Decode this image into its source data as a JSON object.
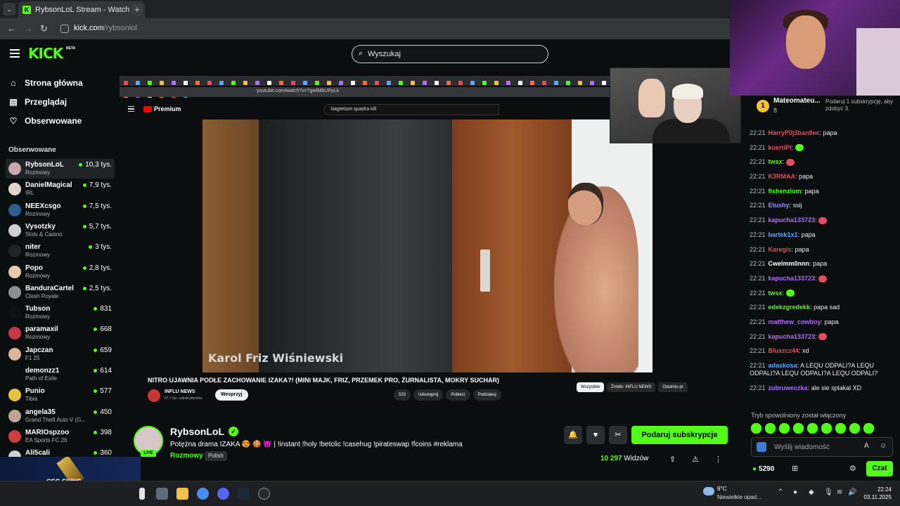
{
  "browser": {
    "tab_title": "RybsonLoL Stream - Watch Live",
    "tab_close": "×",
    "new_tab": "+",
    "url_host": "kick.com",
    "url_path": "/rybsonlol"
  },
  "header": {
    "logo": "KICK",
    "beta": "BETA",
    "search_placeholder": "Wyszukaj"
  },
  "sidebar": {
    "nav": [
      {
        "label": "Strona główna",
        "icon": "home-icon"
      },
      {
        "label": "Przeglądaj",
        "icon": "browse-icon"
      },
      {
        "label": "Obserwowane",
        "icon": "heart-icon"
      }
    ],
    "section_title": "Obserwowane",
    "channels": [
      {
        "name": "RybsonLoL",
        "category": "Rozmowy",
        "viewers": "10,3 tys.",
        "color": "#c9a9ad"
      },
      {
        "name": "DanielMagical",
        "category": "IRL",
        "viewers": "7,9 tys.",
        "color": "#e0d6cf"
      },
      {
        "name": "NEEXcsgo",
        "category": "Rozmowy",
        "viewers": "7,5 tys.",
        "color": "#2d5c8f"
      },
      {
        "name": "Vysotzky",
        "category": "Slots & Casino",
        "viewers": "5,7 tys.",
        "color": "#cfcfcf"
      },
      {
        "name": "niter",
        "category": "Rozmowy",
        "viewers": "3 tys.",
        "color": "#222"
      },
      {
        "name": "Popo",
        "category": "Rozmowy",
        "viewers": "2,8 tys.",
        "color": "#e8c9a8"
      },
      {
        "name": "BanduraCartel",
        "category": "Clash Royale",
        "viewers": "2,5 tys.",
        "color": "#8f8f8f"
      },
      {
        "name": "Tubson",
        "category": "Rozmowy",
        "viewers": "831",
        "color": "#111"
      },
      {
        "name": "paramaxil",
        "category": "Rozmowy",
        "viewers": "668",
        "color": "#c23a4a"
      },
      {
        "name": "Japczan",
        "category": "F1 25",
        "viewers": "659",
        "color": "#d9b4a0"
      },
      {
        "name": "demonzz1",
        "category": "Path of Exile",
        "viewers": "614",
        "color": "#0d0d0d"
      },
      {
        "name": "Punio",
        "category": "Tibia",
        "viewers": "577",
        "color": "#e3c23c"
      },
      {
        "name": "angela35",
        "category": "Grand Theft Auto V (G...",
        "viewers": "450",
        "color": "#bfa39a"
      },
      {
        "name": "MARIOspzoo",
        "category": "EA Sports FC 26",
        "viewers": "398",
        "color": "#c93f3f"
      },
      {
        "name": "Ali5cali",
        "category": "",
        "viewers": "360",
        "color": "#cfcfcf"
      }
    ]
  },
  "video": {
    "inner_url": "youtube.com/watch?v=7gwfMbUPpLk",
    "yt_logo": "Premium",
    "yt_search": "bagietson quadra kill",
    "watermark": "Karol Friz Wiśniewski",
    "yt_title": "NITRO UJAWNIA PODŁE ZACHOWANIE IZAKA?! (MINI MAJK, FRIZ, PRZEMEK PRO, ŻURNALISTA, MOKRY SUCHAR)",
    "yt_channel": "INFLU NEWS",
    "yt_subs": "87,7 tys. subskrybentów",
    "yt_support": "Wesprzyj",
    "yt_actions": [
      "523",
      "Udostępnij",
      "Pobierz",
      "Podziękuj"
    ],
    "yt_chips": [
      "Wszystkie",
      "Źródło: INFLU NEWS",
      "Ostatnio pr"
    ]
  },
  "stream": {
    "name": "RybsonLoL",
    "live": "LIVE",
    "title": "Potężna drama IZAKA 😍 🍪 😈 | !instant !holy !betclic !casehug !pirateswap !fcoins #reklama",
    "category": "Rozmowy",
    "tag": "Polish",
    "subscribe_label": "Podaruj subskrypcje",
    "viewer_count": "10 297",
    "viewer_label": "Widzów"
  },
  "chat": {
    "top_gifter": {
      "rank": "1",
      "name": "Mateomateu...",
      "count": "8"
    },
    "gift_prompt": "Podaruj 1 subskrypcję, aby zdobyć 3.",
    "messages": [
      {
        "time": "22:21",
        "user": "HarryP0j3ban9ec",
        "color": "#e84a5f",
        "text": "papa"
      },
      {
        "time": "22:21",
        "user": "kuertiPl",
        "color": "#e84a5f",
        "text": ""
      },
      {
        "time": "22:21",
        "user": "twsx",
        "color": "#53fc18",
        "text": ""
      },
      {
        "time": "22:21",
        "user": "K3RMAA",
        "color": "#e84a5f",
        "text": "papa"
      },
      {
        "time": "22:21",
        "user": "fishenziom",
        "color": "#53fc18",
        "text": "papa"
      },
      {
        "time": "22:21",
        "user": "Etushy",
        "color": "#9a8cff",
        "text": "ssij"
      },
      {
        "time": "22:21",
        "user": "kapucha133723",
        "color": "#b36bff",
        "text": ""
      },
      {
        "time": "22:21",
        "user": "bartek1x1",
        "color": "#5aa6ff",
        "text": "papa"
      },
      {
        "time": "22:21",
        "user": "Karegis",
        "color": "#e84a5f",
        "text": "papa"
      },
      {
        "time": "22:21",
        "user": "Cwelmm0nnn",
        "color": "#ffffff",
        "text": "papa"
      },
      {
        "time": "22:21",
        "user": "kapucha133723",
        "color": "#b36bff",
        "text": ""
      },
      {
        "time": "22:21",
        "user": "twsx",
        "color": "#53fc18",
        "text": ""
      },
      {
        "time": "22:21",
        "user": "edekzgredekk",
        "color": "#53fc18",
        "text": "papa sad"
      },
      {
        "time": "22:21",
        "user": "matthew_cowboy",
        "color": "#b36bff",
        "text": "papa"
      },
      {
        "time": "22:21",
        "user": "kapucha133723",
        "color": "#b36bff",
        "text": ""
      },
      {
        "time": "22:21",
        "user": "Bluszcz44",
        "color": "#e84a5f",
        "text": "xd"
      },
      {
        "time": "22:21",
        "user": "adaskosa",
        "color": "#5aa6ff",
        "text": "A LEQU ODPALI?A LEQU ODPALI?A LEQU ODPALI?A LEQU ODPALI?"
      },
      {
        "time": "22:21",
        "user": "zubruweczka",
        "color": "#b36bff",
        "text": "ale sie splakal XD"
      }
    ],
    "slow_mode": "Tryb spowolniony został włączony",
    "input_placeholder": "Wyślij wiadomość",
    "points": "5290",
    "send_label": "Czat"
  },
  "ad": {
    "label": "CSG SKINS"
  },
  "taskbar": {
    "temp": "9°C",
    "weather": "Niewielkie opad...",
    "time": "22:24",
    "date": "03.11.2025"
  }
}
